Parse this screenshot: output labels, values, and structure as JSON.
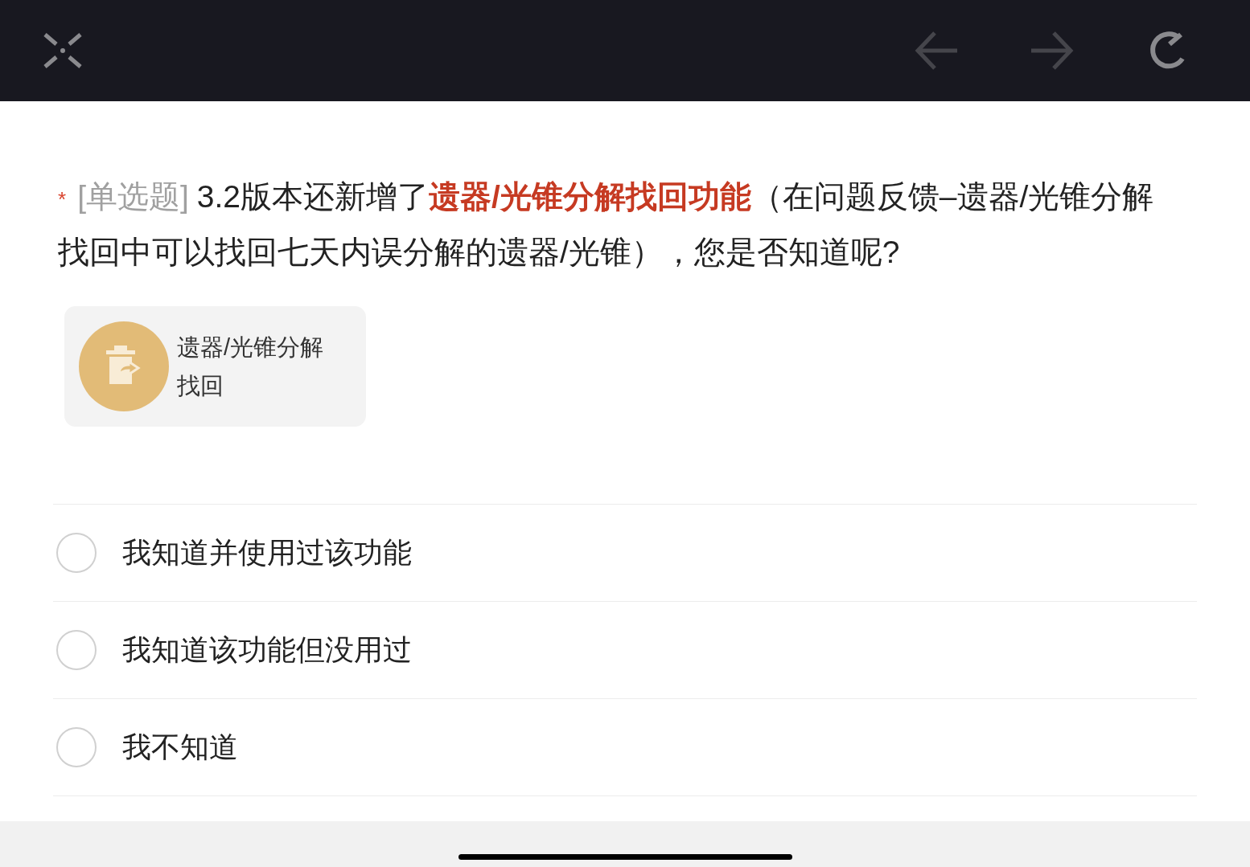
{
  "question": {
    "required": true,
    "required_mark": "*",
    "type_label": "[单选题]",
    "text": "3.2版本还新增了**遗器/光锥分解找回功能**（在问题反馈–遗器/光锥分解找回中可以找回七天内误分解的遗器/光锥），您是否知道呢?"
  },
  "image_card": {
    "label": "遗器/光锥分解找回"
  },
  "options": [
    {
      "label": "我知道并使用过该功能",
      "selected": false
    },
    {
      "label": "我知道该功能但没用过",
      "selected": false
    },
    {
      "label": "我不知道",
      "selected": false
    }
  ]
}
